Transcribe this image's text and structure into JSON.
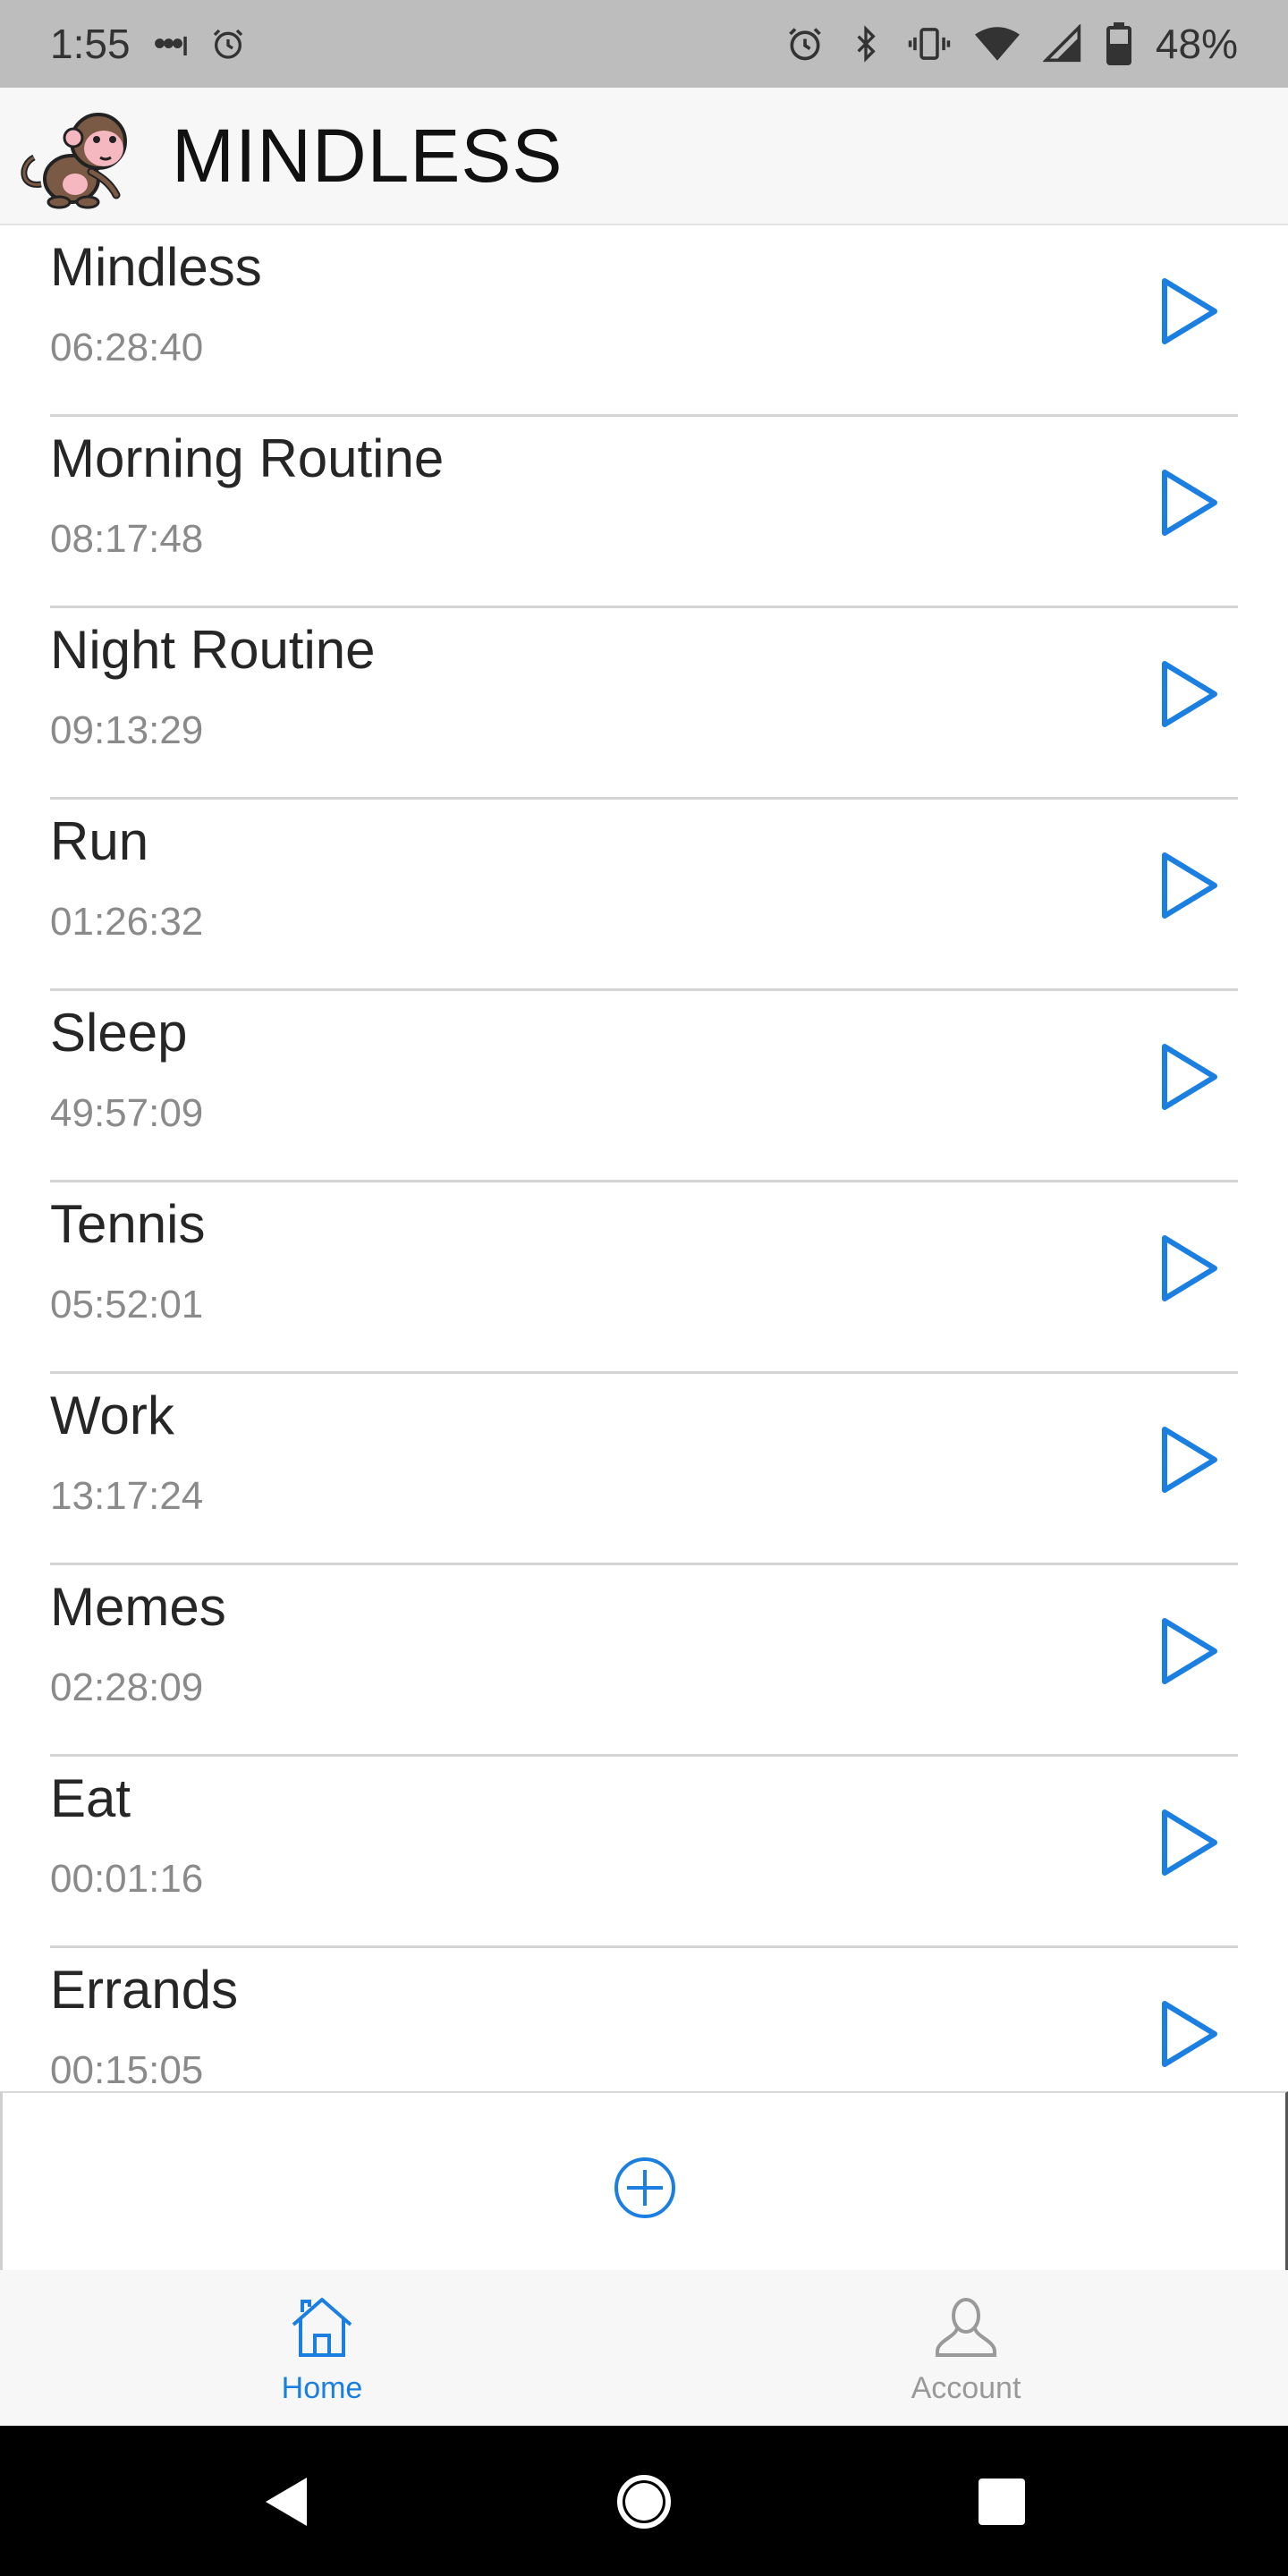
{
  "status_bar": {
    "time": "1:55",
    "dots": "•••ı",
    "battery_percent": "48%",
    "icons": [
      "alarm-icon",
      "bluetooth-icon",
      "vibrate-icon",
      "wifi-icon",
      "signal-icon",
      "battery-icon"
    ]
  },
  "app_bar": {
    "title": "MINDLESS",
    "logo_icon": "monkey-logo"
  },
  "activities": [
    {
      "name": "Mindless",
      "time": "06:28:40"
    },
    {
      "name": "Morning Routine",
      "time": "08:17:48"
    },
    {
      "name": "Night Routine",
      "time": "09:13:29"
    },
    {
      "name": "Run",
      "time": "01:26:32"
    },
    {
      "name": "Sleep",
      "time": "49:57:09"
    },
    {
      "name": "Tennis",
      "time": "05:52:01"
    },
    {
      "name": "Work",
      "time": "13:17:24"
    },
    {
      "name": "Memes",
      "time": "02:28:09"
    },
    {
      "name": "Eat",
      "time": "00:01:16"
    },
    {
      "name": "Errands",
      "time": "00:15:05"
    }
  ],
  "tabs": {
    "home": {
      "label": "Home",
      "icon": "home-icon",
      "active": true
    },
    "account": {
      "label": "Account",
      "icon": "person-icon",
      "active": false
    }
  },
  "colors": {
    "accent": "#1a7fe0",
    "status_bar": "#bdbdbd",
    "app_bar": "#f7f7f7",
    "divider": "#d4d4d4"
  }
}
